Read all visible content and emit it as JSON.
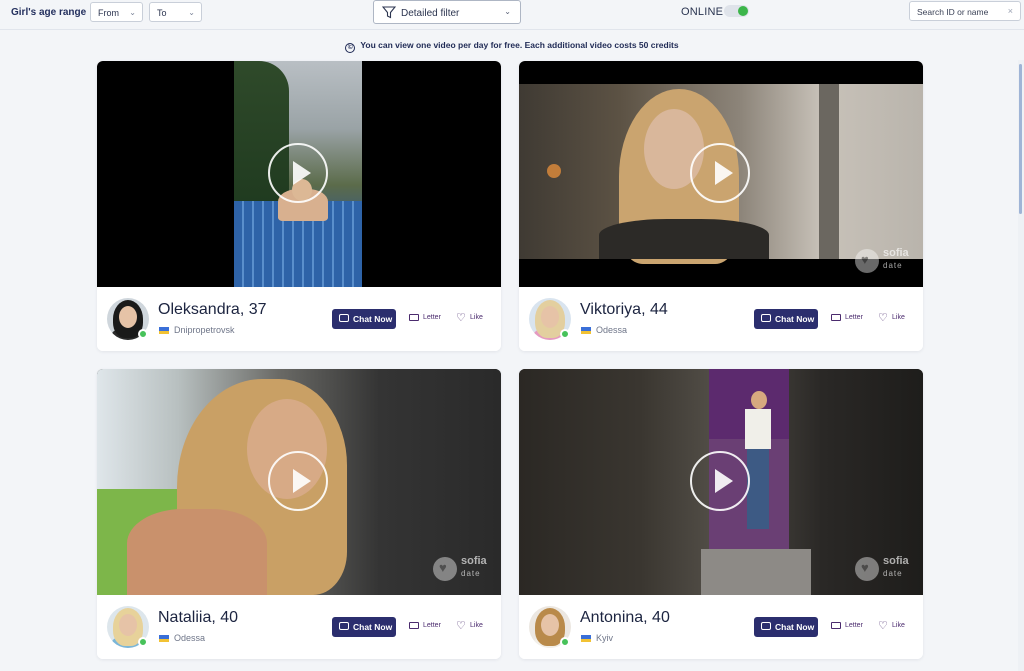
{
  "filters": {
    "age_range_label": "Girl's age range",
    "from_placeholder": "From",
    "to_placeholder": "To",
    "detailed_filter_label": "Detailed filter",
    "online_label": "ONLINE",
    "online_enabled": true,
    "search_placeholder": "Search ID or name"
  },
  "notice": {
    "icon": "credits-icon",
    "text": "You can view one video per day for free. Each additional video costs 50 credits"
  },
  "cards": [
    {
      "name_age": "Oleksandra, 37",
      "city": "Dnipropetrovsk",
      "online": true,
      "chat_label": "Chat Now",
      "letter_label": "Letter",
      "like_label": "Like",
      "watermark": false
    },
    {
      "name_age": "Viktoriya, 44",
      "city": "Odessa",
      "online": true,
      "chat_label": "Chat Now",
      "letter_label": "Letter",
      "like_label": "Like",
      "watermark": true
    },
    {
      "name_age": "Nataliia, 40",
      "city": "Odessa",
      "online": true,
      "chat_label": "Chat Now",
      "letter_label": "Letter",
      "like_label": "Like",
      "watermark": true
    },
    {
      "name_age": "Antonina, 40",
      "city": "Kyiv",
      "online": true,
      "chat_label": "Chat Now",
      "letter_label": "Letter",
      "like_label": "Like",
      "watermark": true
    }
  ],
  "watermark": {
    "line1": "sofia",
    "line2": "date"
  },
  "colors": {
    "accent": "#2b2e6e",
    "online": "#47c25a",
    "action_text": "#4b2b6e"
  }
}
